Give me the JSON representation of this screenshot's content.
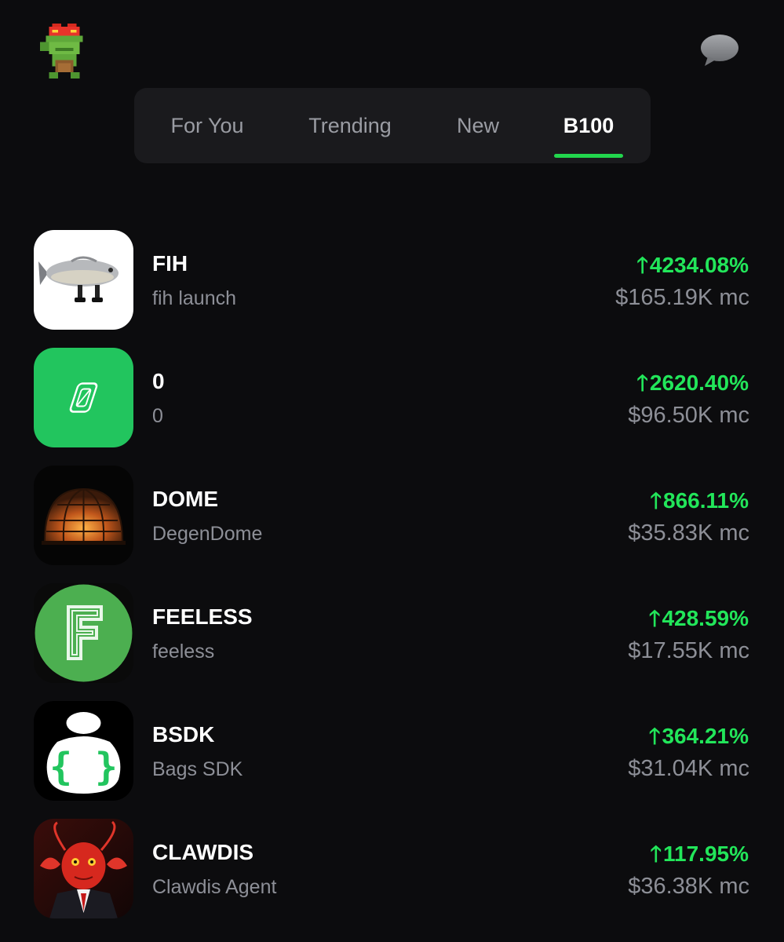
{
  "header": {
    "logo_icon": "pixel-frog-icon",
    "chat_icon": "chat-bubble-icon"
  },
  "tabs": [
    {
      "label": "For You",
      "active": false
    },
    {
      "label": "Trending",
      "active": false
    },
    {
      "label": "New",
      "active": false
    },
    {
      "label": "B100",
      "active": true
    }
  ],
  "colors": {
    "background": "#0c0c0e",
    "tab_bar": "#1a1a1d",
    "accent_green": "#22e65a",
    "muted_text": "#8d8f97"
  },
  "tokens": [
    {
      "ticker": "FIH",
      "name": "fih launch",
      "change": "4234.08%",
      "market_cap": "$165.19K mc",
      "icon": "fish-with-boots-icon"
    },
    {
      "ticker": "0",
      "name": "0",
      "change": "2620.40%",
      "market_cap": "$96.50K mc",
      "icon": "zero-logo-icon"
    },
    {
      "ticker": "DOME",
      "name": "DegenDome",
      "change": "866.11%",
      "market_cap": "$35.83K mc",
      "icon": "glowing-dome-icon"
    },
    {
      "ticker": "FEELESS",
      "name": "feeless",
      "change": "428.59%",
      "market_cap": "$17.55K mc",
      "icon": "letter-f-icon"
    },
    {
      "ticker": "BSDK",
      "name": "Bags SDK",
      "change": "364.21%",
      "market_cap": "$31.04K mc",
      "icon": "bag-braces-icon"
    },
    {
      "ticker": "CLAWDIS",
      "name": "Clawdis Agent",
      "change": "117.95%",
      "market_cap": "$36.38K mc",
      "icon": "red-lobster-agent-icon"
    }
  ],
  "arrow_glyph": "🡑"
}
